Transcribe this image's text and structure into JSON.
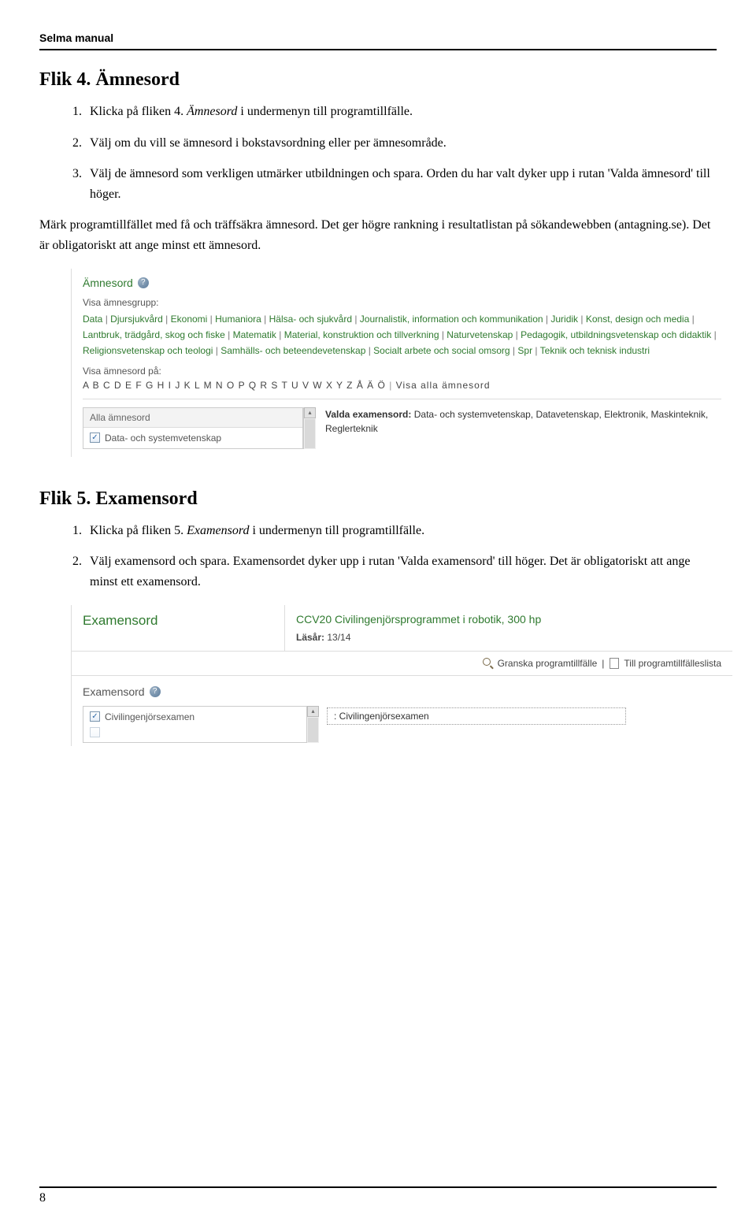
{
  "doc": {
    "header": "Selma manual",
    "page_number": "8"
  },
  "flik4": {
    "heading": "Flik 4. Ämnesord",
    "steps": {
      "s1a": "Klicka på fliken 4. ",
      "s1b": "Ämnesord",
      "s1c": " i undermenyn till programtillfälle.",
      "s2": "Välj om du vill se ämnesord i bokstavsordning eller per ämnesområde.",
      "s3": "Välj de ämnesord som verkligen utmärker utbildningen och spara. Orden du har valt dyker upp i rutan 'Valda ämnesord' till höger."
    },
    "para": "Märk programtillfället med få och träffsäkra ämnesord. Det ger högre rankning i resultatlistan på sökandewebben (antagning.se). Det är obligatoriskt att ange minst ett ämnesord."
  },
  "ss1": {
    "title": "Ämnesord",
    "label_grupp": "Visa ämnesgrupp:",
    "groups": [
      "Data",
      "Djursjukvård",
      "Ekonomi",
      "Humaniora",
      "Hälsa- och sjukvård",
      "Journalistik, information och kommunikation",
      "Juridik",
      "Konst, design och media",
      "Lantbruk, trädgård, skog och fiske",
      "Matematik",
      "Material, konstruktion och tillverkning",
      "Naturvetenskap",
      "Pedagogik, utbildningsvetenskap och didaktik",
      "Religionsvetenskap och teologi",
      "Samhälls- och beteendevetenskap",
      "Socialt arbete och social omsorg",
      "Spr",
      "Teknik och teknisk industri"
    ],
    "label_alpha": "Visa ämnesord på:",
    "alpha": "A B C D E F G H I J K L M N O P Q R S T U V W X Y Z Å Ä Ö",
    "alpha_all": "Visa alla ämnesord",
    "list_header": "Alla ämnesord",
    "list_item": "Data- och systemvetenskap",
    "valda_label": "Valda examensord:",
    "valda_value": " Data- och systemvetenskap, Datavetenskap, Elektronik, Maskinteknik, Reglerteknik"
  },
  "flik5": {
    "heading": "Flik 5. Examensord",
    "steps": {
      "s1a": "Klicka på fliken 5. ",
      "s1b": "Examensord",
      "s1c": " i undermenyn till programtillfälle.",
      "s2": "Välj examensord och spara. Examensordet dyker upp i rutan 'Valda examensord' till höger. Det är obligatoriskt att ange minst ett examensord."
    }
  },
  "ss2": {
    "left_title": "Examensord",
    "prog": "CCV20  Civilingenjörsprogrammet i robotik, 300 hp",
    "lasar_label": "Läsår: ",
    "lasar_value": "13/14",
    "tool_granska": "Granska programtillfälle",
    "tool_till": "Till programtillfälleslista",
    "section_label": "Examensord",
    "list_item": "Civilingenjörsexamen",
    "sel_value": ": Civilingenjörsexamen"
  }
}
